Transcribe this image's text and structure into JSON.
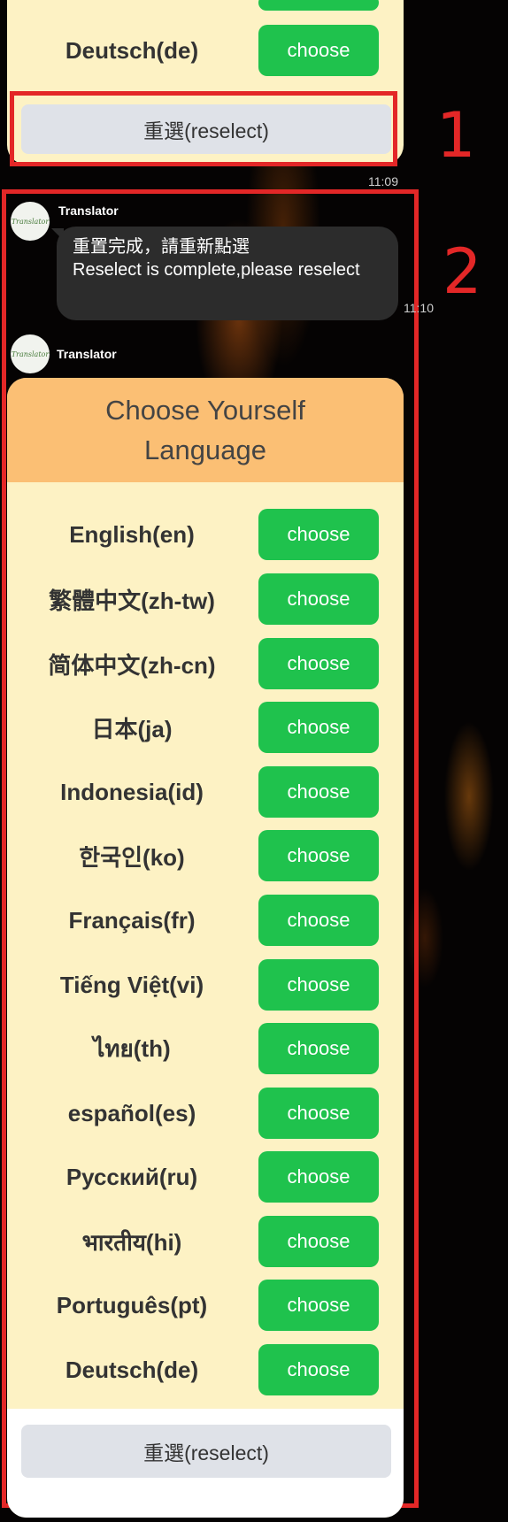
{
  "annotations": {
    "box1": "1",
    "box2": "2"
  },
  "top_card": {
    "rows": [
      {
        "label": "Deutsch(de)",
        "button": "choose"
      }
    ],
    "reselect_label": "重選(reselect)"
  },
  "timestamps": {
    "first": "11:09",
    "second": "11:10"
  },
  "message1": {
    "sender": "Translator",
    "avatar_text": "Translator",
    "line1": "重置完成，請重新點選",
    "line2": "Reselect is complete,please reselect"
  },
  "message2": {
    "sender": "Translator",
    "avatar_text": "Translator",
    "title_line1": "Choose Yourself",
    "title_line2": "Language",
    "languages": [
      {
        "label": "English(en)",
        "button": "choose"
      },
      {
        "label": "繁體中文(zh-tw)",
        "button": "choose"
      },
      {
        "label": "简体中文(zh-cn)",
        "button": "choose"
      },
      {
        "label": "日本(ja)",
        "button": "choose"
      },
      {
        "label": "Indonesia(id)",
        "button": "choose"
      },
      {
        "label": "한국인(ko)",
        "button": "choose"
      },
      {
        "label": "Français(fr)",
        "button": "choose"
      },
      {
        "label": "Tiếng Việt(vi)",
        "button": "choose"
      },
      {
        "label": "ไทย(th)",
        "button": "choose"
      },
      {
        "label": "español(es)",
        "button": "choose"
      },
      {
        "label": "Русский(ru)",
        "button": "choose"
      },
      {
        "label": "भारतीय(hi)",
        "button": "choose"
      },
      {
        "label": "Português(pt)",
        "button": "choose"
      },
      {
        "label": "Deutsch(de)",
        "button": "choose"
      }
    ],
    "reselect_label": "重選(reselect)"
  },
  "colors": {
    "annotation": "#e32727",
    "card_background": "#fdf2c4",
    "header_background": "#fbbf74",
    "choose_button": "#1fc24d",
    "reselect_button": "#dfe2e8",
    "bubble": "#2c2c2c"
  }
}
